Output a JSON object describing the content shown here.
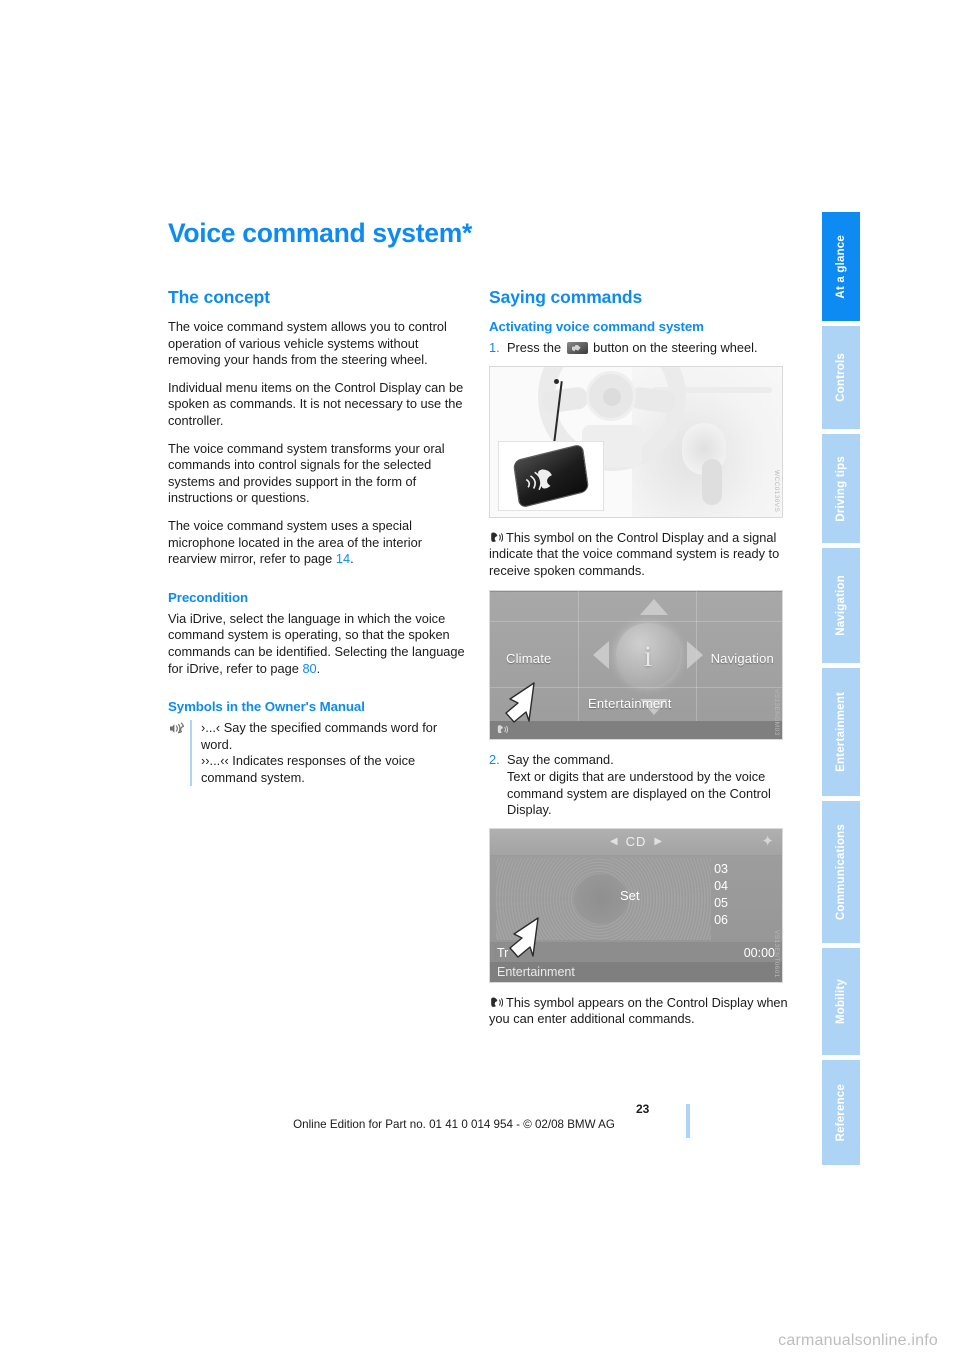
{
  "document": {
    "title": "Voice command system*",
    "page_number": "23",
    "footer": "Online Edition for Part no. 01 41 0 014 954  - © 02/08 BMW AG",
    "watermark": "carmanualsonline.info"
  },
  "tabs": [
    {
      "label": "At a glance",
      "active": true
    },
    {
      "label": "Controls",
      "active": false
    },
    {
      "label": "Driving tips",
      "active": false
    },
    {
      "label": "Navigation",
      "active": false
    },
    {
      "label": "Entertainment",
      "active": false
    },
    {
      "label": "Communications",
      "active": false
    },
    {
      "label": "Mobility",
      "active": false
    },
    {
      "label": "Reference",
      "active": false
    }
  ],
  "colors": {
    "accent": "#0d8bf2",
    "tab_inactive": "#aed4f5",
    "body_text": "#1b1b1b"
  },
  "left_column": {
    "concept": {
      "heading": "The concept",
      "paragraphs": [
        "The voice command system allows you to control operation of various vehicle systems without removing your hands from the steering wheel.",
        "Individual menu items on the Control Display can be spoken as commands. It is not necessary to use the controller.",
        "The voice command system transforms your oral commands into control signals for the selected systems and provides support in the form of instructions or questions."
      ],
      "paragraph_with_ref": {
        "text_before": "The voice command system uses a special microphone located in the area of the interior rearview mirror, refer to page ",
        "page_ref": "14",
        "text_after": "."
      }
    },
    "precondition": {
      "heading": "Precondition",
      "text_before": "Via iDrive, select the language in which the voice command system is operating, so that the spoken commands can be identified. Selecting the language for iDrive, refer to page ",
      "page_ref": "80",
      "text_after": "."
    },
    "symbols": {
      "heading": "Symbols in the Owner's Manual",
      "icon": "voice-speaking-icon",
      "line1": "›...‹ Say the specified commands word for word.",
      "line2": "››...‹‹ Indicates responses of the voice command system."
    }
  },
  "right_column": {
    "heading": "Saying commands",
    "subheading": "Activating voice command system",
    "step1": {
      "number": "1.",
      "text_before": "Press the ",
      "button_icon": "voice-button-icon",
      "text_after": " button on the steering wheel."
    },
    "figure1": {
      "name": "steering-wheel-voice-button-photo",
      "code": "WCC0130VS"
    },
    "caption1": {
      "symbol": "voice-ready-symbol",
      "text": "This symbol on the Control Display and a signal indicate that the voice command system is ready to receive spoken commands."
    },
    "figure2": {
      "name": "idrive-main-menu-screenshot",
      "code": "VS13ENGM03",
      "menu_items": {
        "left": "Climate",
        "right": "Navigation",
        "bottom": "Entertainment",
        "center_icon": "info-i-icon"
      },
      "status_symbol": "voice-ready-symbol"
    },
    "step2": {
      "number": "2.",
      "title": "Say the command.",
      "text": "Text or digits that are understood by the voice command system are displayed on the Control Display."
    },
    "figure3": {
      "name": "cd-playback-screenshot",
      "code": "VS13ENT0601",
      "header": "CD",
      "gear_icon": "options-icon",
      "center_label": "Set",
      "tracks": [
        "03",
        "04",
        "05",
        "06"
      ],
      "track_label": "Tr",
      "time": "00:00",
      "bottom_label": "Entertainment"
    },
    "caption2": {
      "symbol": "voice-ready-symbol",
      "text": "This symbol appears on the Control Display when you can enter additional commands."
    }
  }
}
